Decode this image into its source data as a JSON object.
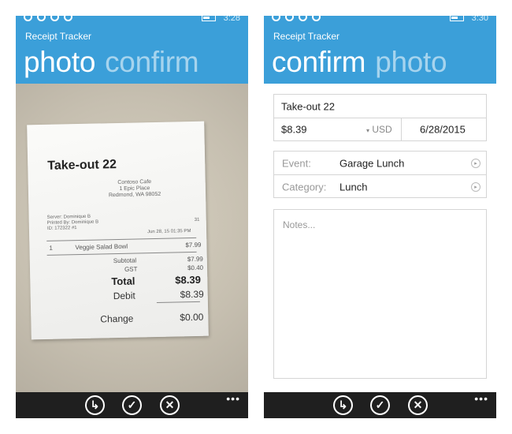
{
  "status": {
    "time_left": "3:28",
    "time_right": "3:30"
  },
  "left_screen": {
    "app_title": "Receipt Tracker",
    "pivot_active": "photo",
    "pivot_inactive": "confirm",
    "receipt": {
      "title": "Take-out 22",
      "store_name": "Contoso Cafe",
      "store_addr1": "1 Epic Place",
      "store_addr2": "Redmond, WA 98052",
      "server": "Server: Dominique B",
      "printed_by": "Printed By: Dominique B",
      "id_line": "ID: 172322 #1",
      "table": "31",
      "datetime": "Jun 28, 15 01:35 PM",
      "item_qty": "1",
      "item_name": "Veggie Salad Bowl",
      "item_price": "$7.99",
      "subtotal_label": "Subtotal",
      "subtotal_value": "$7.99",
      "gst_label": "GST",
      "gst_value": "$0.40",
      "total_label": "Total",
      "total_value": "$8.39",
      "debit_label": "Debit",
      "debit_value": "$8.39",
      "change_label": "Change",
      "change_value": "$0.00"
    }
  },
  "right_screen": {
    "app_title": "Receipt Tracker",
    "pivot_active": "confirm",
    "pivot_inactive": "photo",
    "form": {
      "title_value": "Take-out 22",
      "amount_value": "$8.39",
      "currency": "USD",
      "date_value": "6/28/2015",
      "event_label": "Event:",
      "event_value": "Garage Lunch",
      "category_label": "Category:",
      "category_value": "Lunch",
      "notes_placeholder": "Notes..."
    }
  },
  "app_bar": {
    "more": "•••"
  },
  "colors": {
    "accent": "#3b9fd9",
    "app_bar": "#1f1f1f"
  }
}
